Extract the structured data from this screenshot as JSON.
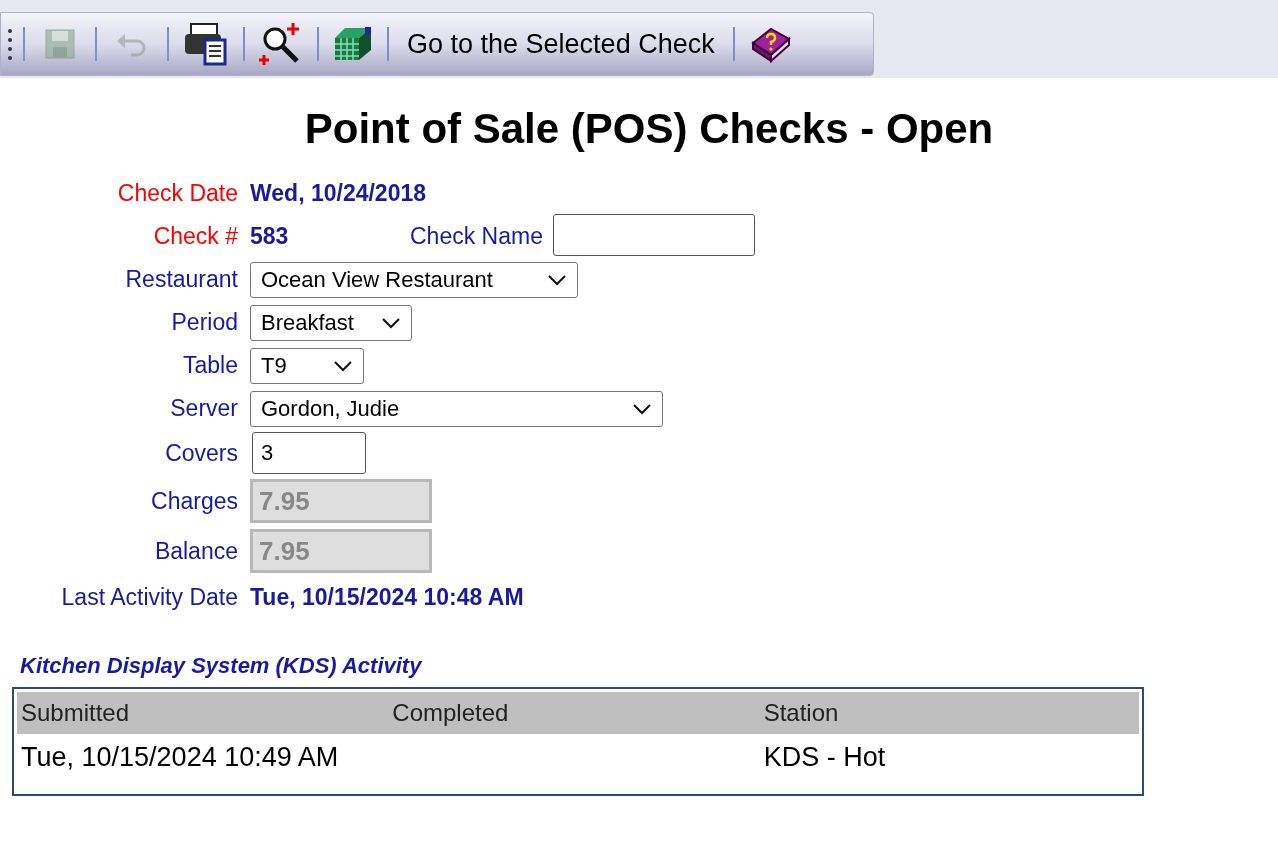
{
  "toolbar": [
    {
      "kind": "grip"
    },
    {
      "kind": "icon",
      "disabled": true
    },
    {
      "kind": "icon",
      "disabled": true
    },
    {
      "kind": "icon",
      "disabled": false
    },
    {
      "kind": "icon",
      "disabled": false
    },
    {
      "kind": "icon",
      "disabled": false
    },
    {
      "kind": "text",
      "label": "Go to the Selected Check"
    },
    {
      "kind": "icon",
      "disabled": false
    }
  ],
  "title": "Point of Sale (POS) Checks - Open",
  "fields": [
    {
      "label": "Check Date",
      "required": true,
      "kind": "text",
      "value": "Wed, 10/24/2018"
    },
    {
      "label": "Check #",
      "required": true,
      "kind": "text",
      "value": "583",
      "extra": {
        "label": "Check Name"
      }
    },
    {
      "label": "Restaurant",
      "required": false,
      "kind": "select",
      "value": "Ocean View Restaurant"
    },
    {
      "label": "Period",
      "required": false,
      "kind": "select",
      "value": "Breakfast"
    },
    {
      "label": "Table",
      "required": false,
      "kind": "select",
      "value": "T9"
    },
    {
      "label": "Server",
      "required": false,
      "kind": "select",
      "value": "Gordon, Judie"
    },
    {
      "label": "Covers",
      "required": false,
      "kind": "input",
      "value": "3"
    },
    {
      "label": "Charges",
      "required": false,
      "kind": "readonly",
      "value": "7.95"
    },
    {
      "label": "Balance",
      "required": false,
      "kind": "readonly",
      "value": "7.95"
    },
    {
      "label": "Last Activity Date",
      "required": false,
      "kind": "text",
      "value": "Tue, 10/15/2024 10:48 AM"
    }
  ],
  "kds": {
    "title": "Kitchen Display System (KDS) Activity",
    "columns": [
      "Submitted",
      "Completed",
      "Station"
    ],
    "rows": [
      [
        "Tue, 10/15/2024 10:49 AM",
        "",
        "KDS - Hot"
      ]
    ]
  }
}
